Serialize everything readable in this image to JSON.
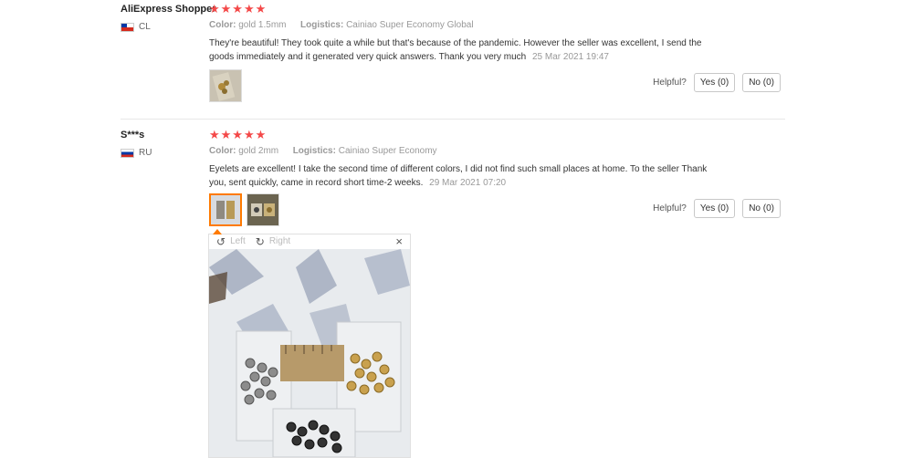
{
  "reviews": [
    {
      "user": "AliExpress Shopper",
      "country": "CL",
      "stars": "★★★★★",
      "color_label": "Color:",
      "color_value": "gold 1.5mm",
      "logistics_label": "Logistics:",
      "logistics_value": "Cainiao Super Economy Global",
      "text": "They're beautiful! They took quite a while but that's because of the pandemic. However the seller was excellent, I send the goods immediately and it generated very quick answers. Thank you very much",
      "date": "25 Mar 2021 19:47",
      "helpful_label": "Helpful?",
      "yes_label": "Yes (0)",
      "no_label": "No (0)"
    },
    {
      "user": "S***s",
      "country": "RU",
      "stars": "★★★★★",
      "color_label": "Color:",
      "color_value": "gold 2mm",
      "logistics_label": "Logistics:",
      "logistics_value": "Cainiao Super Economy",
      "text": "Eyelets are excellent! I take the second time of different colors, I did not find such small places at home. To the seller Thank you, sent quickly, came in record short time-2 weeks.",
      "date": "29 Mar 2021 07:20",
      "helpful_label": "Helpful?",
      "yes_label": "Yes (0)",
      "no_label": "No (0)"
    }
  ],
  "viewer": {
    "rotate_left_label": "Left",
    "rotate_right_label": "Right",
    "close_icon": "close-icon",
    "rotate_left_icon": "rotate-left-icon",
    "rotate_right_icon": "rotate-right-icon"
  },
  "colors": {
    "star": "#f44848",
    "selected_thumb": "#ff7a00"
  }
}
